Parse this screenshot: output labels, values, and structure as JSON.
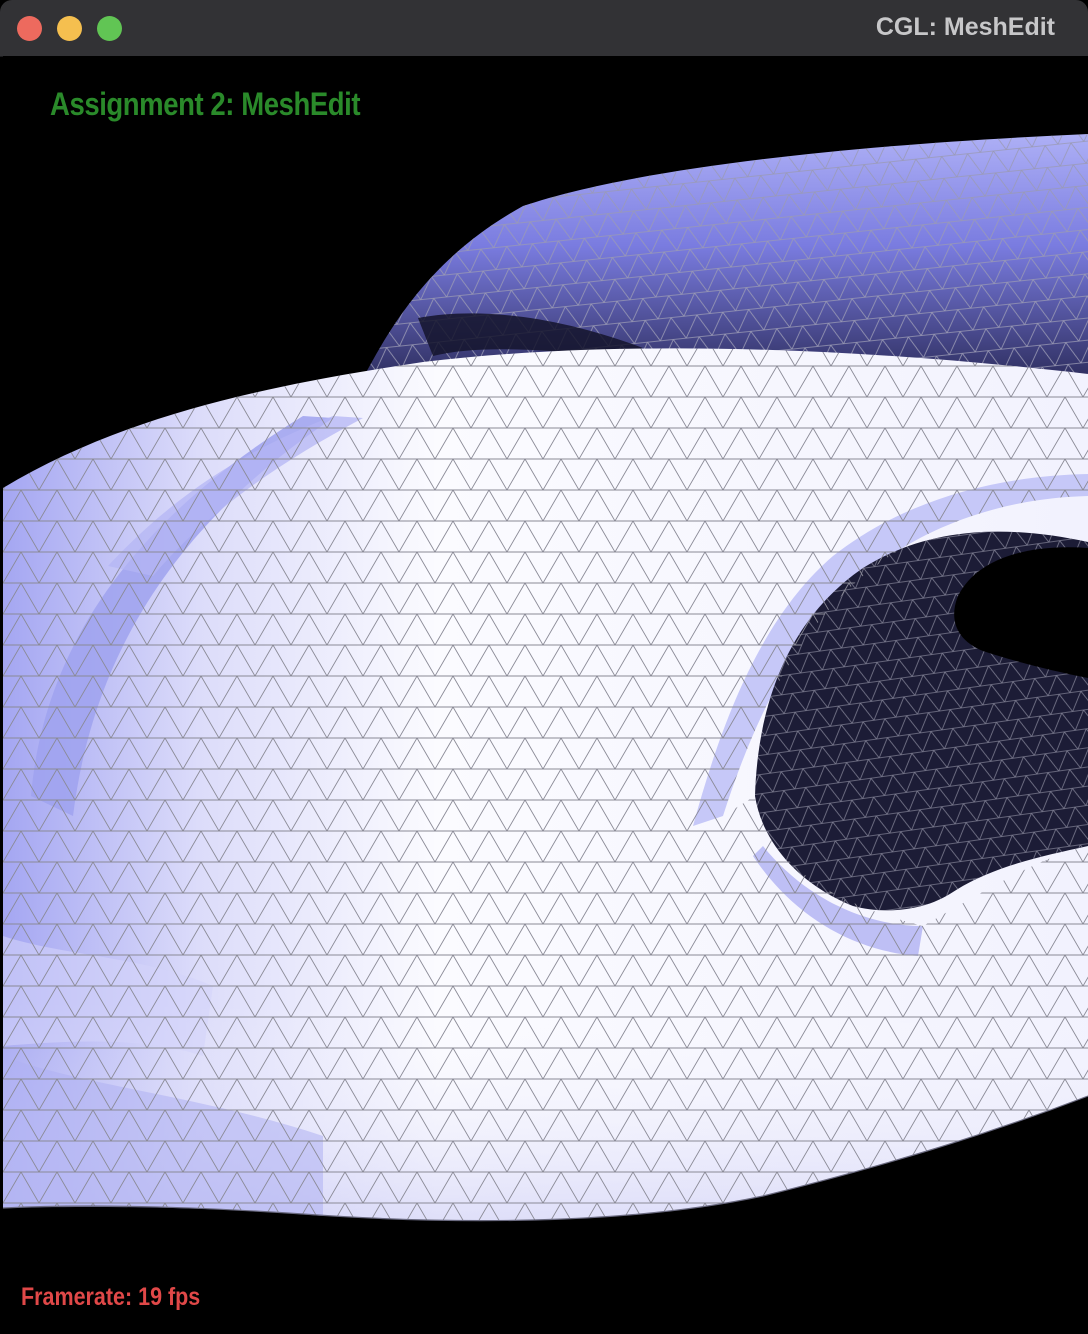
{
  "window": {
    "title": "CGL: MeshEdit"
  },
  "overlay": {
    "assignment_title": "Assignment 2: MeshEdit",
    "framerate_label": "Framerate: 19 fps"
  },
  "colors": {
    "background": "#000000",
    "titlebar": "#323235",
    "assignment_title": "#2a8a2a",
    "framerate": "#e04848",
    "mesh_light": "#f4f4ff",
    "mesh_shade": "#8c8cf0",
    "mesh_dark": "#1c1c36",
    "wire": "#8a8a96"
  },
  "icons": {
    "close": "close-icon",
    "minimize": "minimize-icon",
    "maximize": "maximize-icon"
  }
}
